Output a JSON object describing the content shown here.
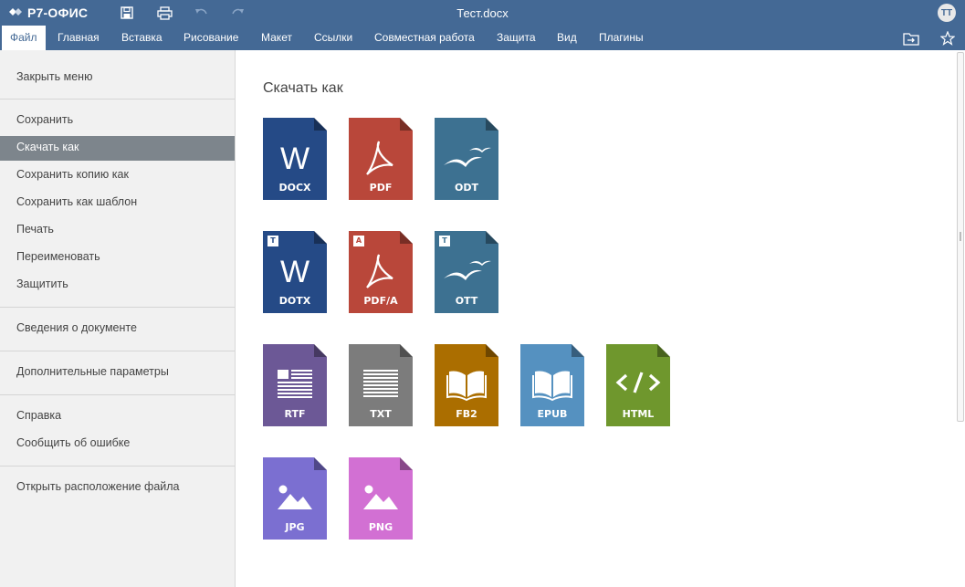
{
  "app": {
    "logo_text": "Р7-ОФИС",
    "document_title": "Тест.docx",
    "user_initials": "ТТ"
  },
  "toolbar": {
    "icons": [
      "save-icon",
      "print-icon",
      "undo-icon",
      "redo-icon"
    ]
  },
  "tabs": [
    {
      "label": "Файл",
      "active": true
    },
    {
      "label": "Главная"
    },
    {
      "label": "Вставка"
    },
    {
      "label": "Рисование"
    },
    {
      "label": "Макет"
    },
    {
      "label": "Ссылки"
    },
    {
      "label": "Совместная работа"
    },
    {
      "label": "Защита"
    },
    {
      "label": "Вид"
    },
    {
      "label": "Плагины"
    }
  ],
  "tab_icons": [
    "open-file-location-icon",
    "favorite-star-icon"
  ],
  "menu": {
    "items": [
      "Закрыть меню",
      "Сохранить",
      "Скачать как",
      "Сохранить копию как",
      "Сохранить как шаблон",
      "Печать",
      "Переименовать",
      "Защитить",
      "Сведения о документе",
      "Дополнительные параметры",
      "Справка",
      "Сообщить об ошибке",
      "Открыть расположение файла"
    ],
    "selected": "Скачать как"
  },
  "panel": {
    "title": "Скачать как",
    "formats": [
      {
        "label": "DOCX",
        "color": "#254a86",
        "icon": "word-icon"
      },
      {
        "label": "PDF",
        "color": "#b9473a",
        "icon": "pdf-icon"
      },
      {
        "label": "ODT",
        "color": "#3d7191",
        "icon": "gulls-icon"
      },
      {
        "label": "DOTX",
        "color": "#254a86",
        "icon": "word-icon",
        "badge": "T"
      },
      {
        "label": "PDF/A",
        "color": "#b9473a",
        "icon": "pdf-icon",
        "badge": "A"
      },
      {
        "label": "OTT",
        "color": "#3d7191",
        "icon": "gulls-icon",
        "badge": "T"
      },
      {
        "label": "RTF",
        "color": "#6c5896",
        "icon": "rtf-icon"
      },
      {
        "label": "TXT",
        "color": "#7c7c7c",
        "icon": "txt-icon"
      },
      {
        "label": "FB2",
        "color": "#ab6e00",
        "icon": "book-icon"
      },
      {
        "label": "EPUB",
        "color": "#5591c0",
        "icon": "book-icon"
      },
      {
        "label": "HTML",
        "color": "#6f972d",
        "icon": "code-icon"
      },
      {
        "label": "JPG",
        "color": "#7b6fd1",
        "icon": "image-icon"
      },
      {
        "label": "PNG",
        "color": "#d270d3",
        "icon": "image-icon"
      }
    ]
  }
}
